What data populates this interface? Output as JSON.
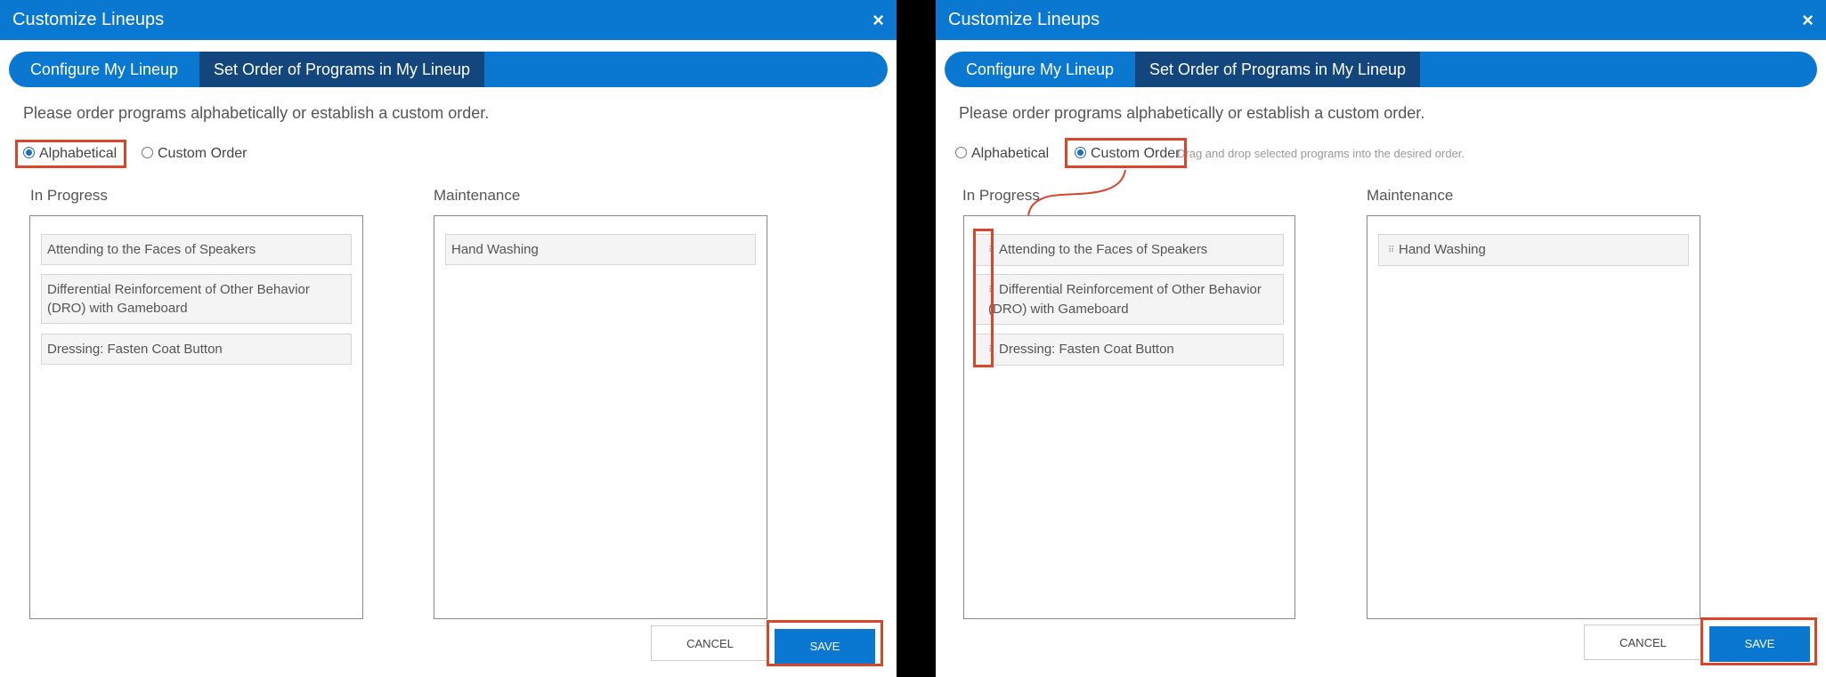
{
  "colors": {
    "primary": "#0a77d0",
    "tab_active": "#12467d",
    "highlight": "#d9472b"
  },
  "left": {
    "title": "Customize Lineups",
    "close_icon": "×",
    "tabs": [
      {
        "label": "Configure My Lineup"
      },
      {
        "label": "Set Order of Programs in My Lineup"
      }
    ],
    "instructions": "Please order programs alphabetically or establish a custom order.",
    "radios": [
      {
        "label": "Alphabetical",
        "selected": true
      },
      {
        "label": "Custom Order",
        "selected": false
      }
    ],
    "columns": [
      {
        "label": "In Progress",
        "items": [
          "Attending to the Faces of Speakers",
          "Differential Reinforcement of Other Behavior (DRO) with Gameboard",
          "Dressing: Fasten Coat Button"
        ]
      },
      {
        "label": "Maintenance",
        "items": [
          "Hand Washing"
        ]
      }
    ],
    "cancel_label": "CANCEL",
    "save_label": "SAVE"
  },
  "right": {
    "title": "Customize Lineups",
    "close_icon": "×",
    "tabs": [
      {
        "label": "Configure My Lineup"
      },
      {
        "label": "Set Order of Programs in My Lineup"
      }
    ],
    "instructions": "Please order programs alphabetically or establish a custom order.",
    "radios": [
      {
        "label": "Alphabetical",
        "selected": false
      },
      {
        "label": "Custom Order",
        "selected": true
      }
    ],
    "hint": "Drag and drop selected programs into the desired order.",
    "columns": [
      {
        "label": "In Progress",
        "items": [
          "Attending to the Faces of Speakers",
          "Differential Reinforcement of Other Behavior (DRO) with Gameboard",
          "Dressing: Fasten Coat Button"
        ]
      },
      {
        "label": "Maintenance",
        "items": [
          "Hand Washing"
        ]
      }
    ],
    "cancel_label": "CANCEL",
    "save_label": "SAVE"
  }
}
